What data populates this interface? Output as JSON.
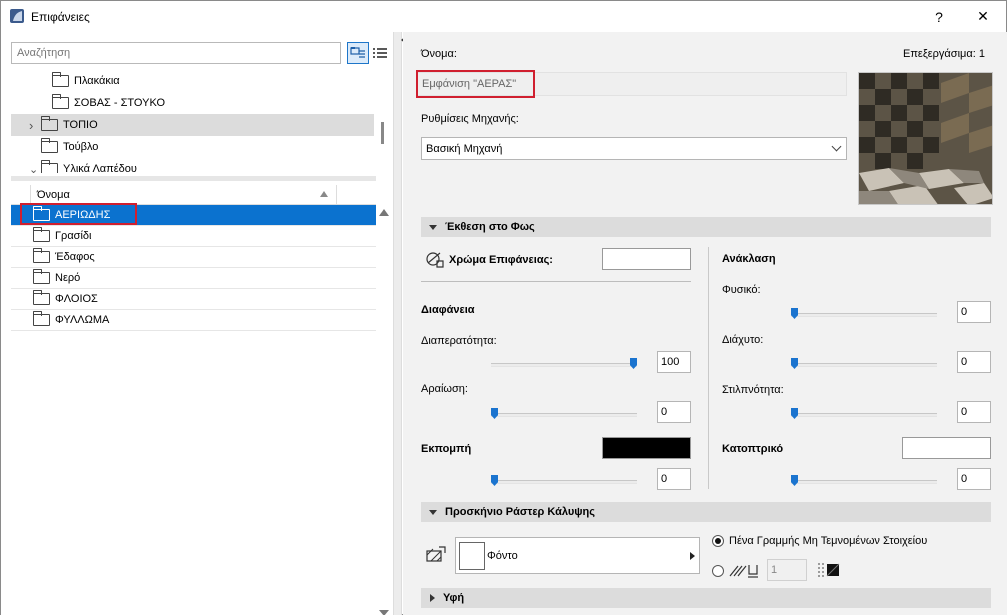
{
  "window": {
    "title": "Επιφάνειες",
    "help_label": "?",
    "close_label": "✕"
  },
  "search": {
    "placeholder": "Αναζήτηση"
  },
  "tree": {
    "items": [
      {
        "label": "Πλακάκια",
        "expander": ""
      },
      {
        "label": "ΣΟΒΑΣ - ΣΤΟΥΚΟ",
        "expander": ""
      },
      {
        "label": "ΤΟΠΙΟ",
        "expander": "›"
      },
      {
        "label": "Τούβλο",
        "expander": ""
      },
      {
        "label": "Υλικά Λαπέδου",
        "expander": "⌄"
      }
    ]
  },
  "list": {
    "header": "Όνομα",
    "items": [
      "ΑΕΡΙΩΔΗΣ",
      "Γρασίδι",
      "Έδαφος",
      "Νερό",
      "ΦΛΟΙΟΣ",
      "ΦΥΛΛΩΜΑ"
    ]
  },
  "settings": {
    "name_label": "Όνομα:",
    "editing_label": "Επεξεργάσιμα: 1",
    "name_value": "Εμφάνιση \"ΑΕΡΑΣ\"",
    "engine_label": "Ρυθμίσεις Μηχανής:",
    "engine_value": "Βασική Μηχανή"
  },
  "exposure": {
    "title": "Έκθεση στο Φως",
    "surface_color_label": "Χρώμα Επιφάνειας:",
    "surface_color": "#ffffff",
    "transparency_title": "Διαφάνεια",
    "transmittance_label": "Διαπερατότητα:",
    "transmittance_value": "100",
    "attenuation_label": "Αραίωση:",
    "attenuation_value": "0",
    "emission_label": "Εκπομπή",
    "emission_color": "#000000",
    "emission_value": "0",
    "reflection_title": "Ανάκλαση",
    "natural_label": "Φυσικό:",
    "natural_value": "0",
    "diffuse_label": "Διάχυτο:",
    "diffuse_value": "0",
    "shininess_label": "Στιλπνότητα:",
    "shininess_value": "0",
    "specular_label": "Κατοπτρικό",
    "specular_color": "#ffffff",
    "specular_value": "0"
  },
  "cover_fill": {
    "title": "Προσκήνιο Ράστερ Κάλυψης",
    "fill_label": "Φόντο",
    "pen_option_label": "Πένα Γραμμής Μη Τεμνομένων Στοιχείου",
    "pen_number": "1"
  },
  "texture": {
    "title": "Υφή"
  }
}
